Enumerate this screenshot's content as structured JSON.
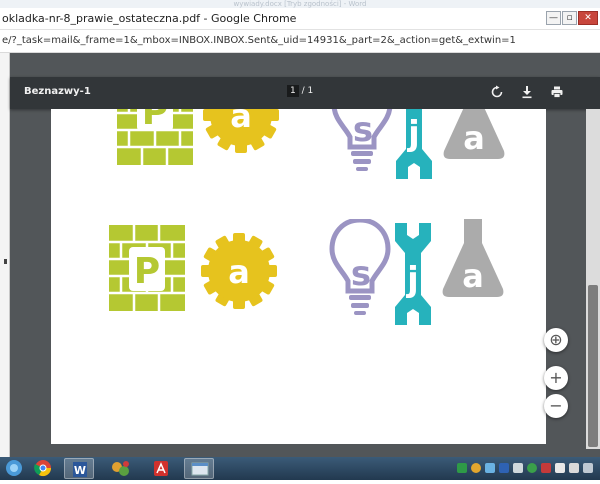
{
  "word": {
    "title": "wywiady.docx [Tryb zgodności] - Word"
  },
  "chrome": {
    "window_title": "okladka-nr-8_prawie_ostateczna.pdf - Google Chrome",
    "url": "e/?_task=mail&_frame=1&_mbox=INBOX.INBOX.Sent&_uid=14931&_part=2&_action=get&_extwin=1",
    "minimize_glyph": "—",
    "maximize_glyph": "▫",
    "close_glyph": "✕"
  },
  "viewer": {
    "doc_title": "Beznazwy-1",
    "page_current": "1",
    "page_total": "/ 1",
    "fit_glyph": "⊕",
    "zoom_in_glyph": "+",
    "zoom_out_glyph": "−"
  },
  "logo": {
    "letters": [
      "P",
      "a",
      "s",
      "j",
      "a"
    ]
  },
  "colors": {
    "brick": "#b5c832",
    "gear": "#e6c31e",
    "bulb": "#9b94c3",
    "wrench": "#26b2bc",
    "flask": "#ababab"
  },
  "taskbar": {
    "items": [
      {
        "name": "taskbar-start-icon"
      },
      {
        "name": "taskbar-chrome-icon"
      },
      {
        "name": "taskbar-word-icon"
      },
      {
        "name": "taskbar-app-icon"
      },
      {
        "name": "taskbar-acrobat-icon"
      },
      {
        "name": "taskbar-window-icon"
      }
    ]
  }
}
